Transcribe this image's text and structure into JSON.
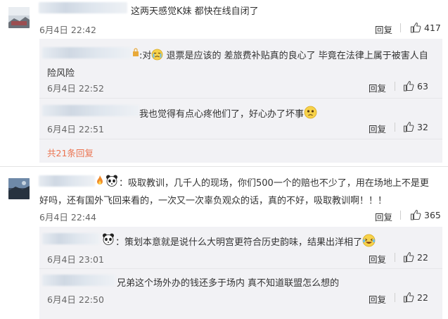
{
  "comments": [
    {
      "text": "这两天感觉K妹 都快在线自闭了",
      "date": "6月4日 22:42",
      "reply_label": "回复",
      "likes": "417",
      "replies": [
        {
          "prefix": ":对",
          "text": "退票是应该的 差旅费补贴真的良心了 毕竟在法律上属于被害人自",
          "text_line2": "险风险",
          "date": "6月4日 22:52",
          "reply_label": "回复",
          "likes": "63"
        },
        {
          "text": "我也觉得有点心疼他们了，好心办了坏事",
          "date": "6月4日 22:51",
          "reply_label": "回复",
          "likes": "32"
        }
      ],
      "more_replies": "共21条回复"
    },
    {
      "text": "：吸取教训，几千人的现场，你们500一个的赔也不少了，用在场地上不是更",
      "text_line2": "好吗，还有国外飞回来看的，一次又一次辜负观众的话，真的不好，吸取教训啊！！！",
      "date": "6月4日 22:44",
      "reply_label": "回复",
      "likes": "365",
      "replies": [
        {
          "text": "：策划本意就是说什么大明宫更符合历史韵味，结果出洋相了",
          "date": "6月4日 23:01",
          "reply_label": "回复",
          "likes": "22"
        },
        {
          "text": "兄弟这个场外办的钱还多于场内 真不知道联盟怎么想的",
          "date": "6月4日 22:50",
          "reply_label": "回复",
          "likes": "22"
        }
      ]
    }
  ],
  "colors": {
    "link": "#eb7350",
    "sub_bg": "#f2f2f5",
    "text": "#333333",
    "meta": "#666666"
  }
}
